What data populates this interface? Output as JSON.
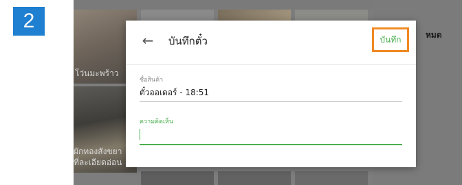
{
  "step": {
    "number": "2"
  },
  "background": {
    "tile_labels": [
      "โว่นมะพร้าว",
      "ผักทองสังขยา",
      "ที่ละเอียดอ่อน"
    ],
    "right_label": "หมด"
  },
  "dialog": {
    "title": "บันทึกตั๋ว",
    "back_icon": "arrow-left-icon",
    "save_label": "บันทึก",
    "product_field": {
      "label": "ชื่อสินค้า",
      "value": "ตั๋วออเดอร์ - 18:51"
    },
    "comment_field": {
      "label": "ความคิดเห็น",
      "value": ""
    }
  },
  "colors": {
    "accent": "#4caf50",
    "highlight": "#f08a24",
    "step_badge": "#1f7fd0"
  }
}
